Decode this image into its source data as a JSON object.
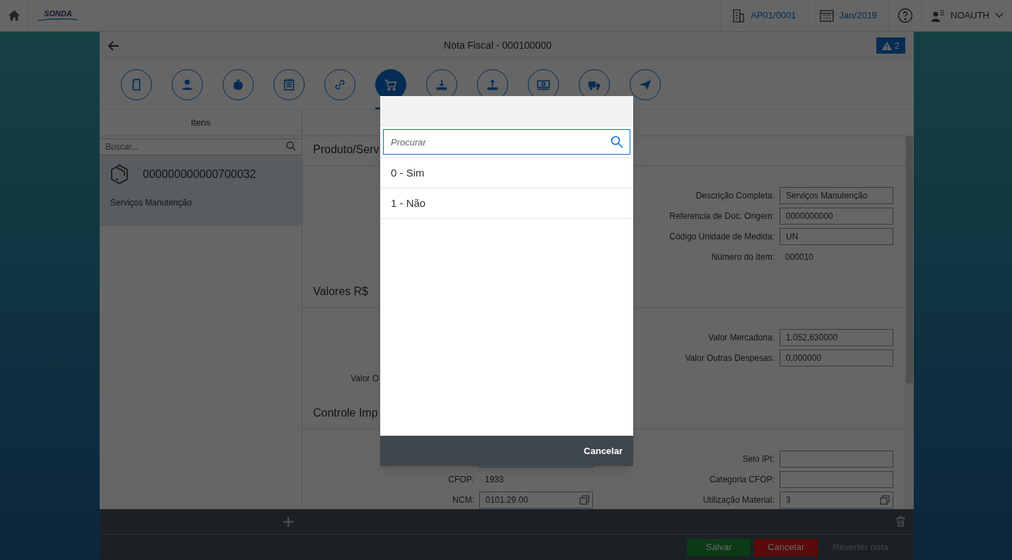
{
  "top_bar": {
    "logo": "SONDA",
    "company": "AP01/0001",
    "period": "Jan/2019",
    "user": "NOAUTH"
  },
  "title_bar": {
    "title": "Nota Fiscal - 000100000",
    "alerts": "2"
  },
  "tabs": [
    {
      "selected": false
    },
    {
      "selected": false
    },
    {
      "selected": false
    },
    {
      "selected": false
    },
    {
      "selected": false
    },
    {
      "selected": true
    },
    {
      "selected": false
    },
    {
      "selected": false
    },
    {
      "selected": false
    },
    {
      "selected": false
    },
    {
      "selected": false
    }
  ],
  "items_panel": {
    "title": "Itens",
    "search": {
      "placeholder": "Buscar..."
    },
    "items": [
      {
        "code": "000000000000700032",
        "description": "Serviços Manutenção",
        "selected": true
      }
    ]
  },
  "sections": [
    {
      "title": "Produto/Serv",
      "rows": [
        {
          "right": {
            "kind": "input",
            "label": "Descrição Completa:",
            "value": "Serviços Manutenção"
          }
        },
        {
          "right": {
            "kind": "input",
            "label": "Referencia de Doc. Origem:",
            "value": "0000000000"
          }
        },
        {
          "right": {
            "kind": "input",
            "label": "Código Unidade de Medida:",
            "value": "UN"
          }
        },
        {
          "right": {
            "kind": "text",
            "label": "Número do Item:",
            "value": "000010"
          }
        }
      ]
    },
    {
      "title": "Valores R$",
      "rows": [
        {
          "right": {
            "kind": "input",
            "label": "Valor Mercadoria:",
            "value": "1.052,630000"
          }
        },
        {
          "right": {
            "kind": "input",
            "label": "Valor Outras Despesas:",
            "value": "0,000000"
          }
        },
        {
          "left": {
            "kind": "covered",
            "label": "Valor O"
          }
        }
      ]
    },
    {
      "title": "Controle Imp",
      "rows": [
        {
          "left": {
            "kind": "input"
          },
          "right": {
            "kind": "input",
            "label": "Selo IPI:"
          }
        },
        {
          "left": {
            "kind": "text",
            "label": "CFOP:",
            "value": "1933"
          },
          "right": {
            "kind": "input",
            "label": "Categoria CFOP:"
          }
        },
        {
          "left": {
            "kind": "lookup",
            "label": "NCM:",
            "value": "0101.29.00"
          },
          "right": {
            "kind": "lookup",
            "label": "Utilização Material:",
            "value": "3"
          }
        }
      ]
    }
  ],
  "footer": {
    "buttons": [
      {
        "label": "Salvar",
        "kind": "accept",
        "disabled": false
      },
      {
        "label": "Cancelar",
        "kind": "reject",
        "disabled": false
      },
      {
        "label": "Reverter nota",
        "kind": "plain",
        "disabled": true
      }
    ]
  },
  "dialog": {
    "search": {
      "placeholder": "Procurar"
    },
    "options": [
      {
        "label": "0 - Sim",
        "selected": false
      },
      {
        "label": "1 - Não",
        "selected": false
      }
    ],
    "cancel": "Cancelar"
  }
}
